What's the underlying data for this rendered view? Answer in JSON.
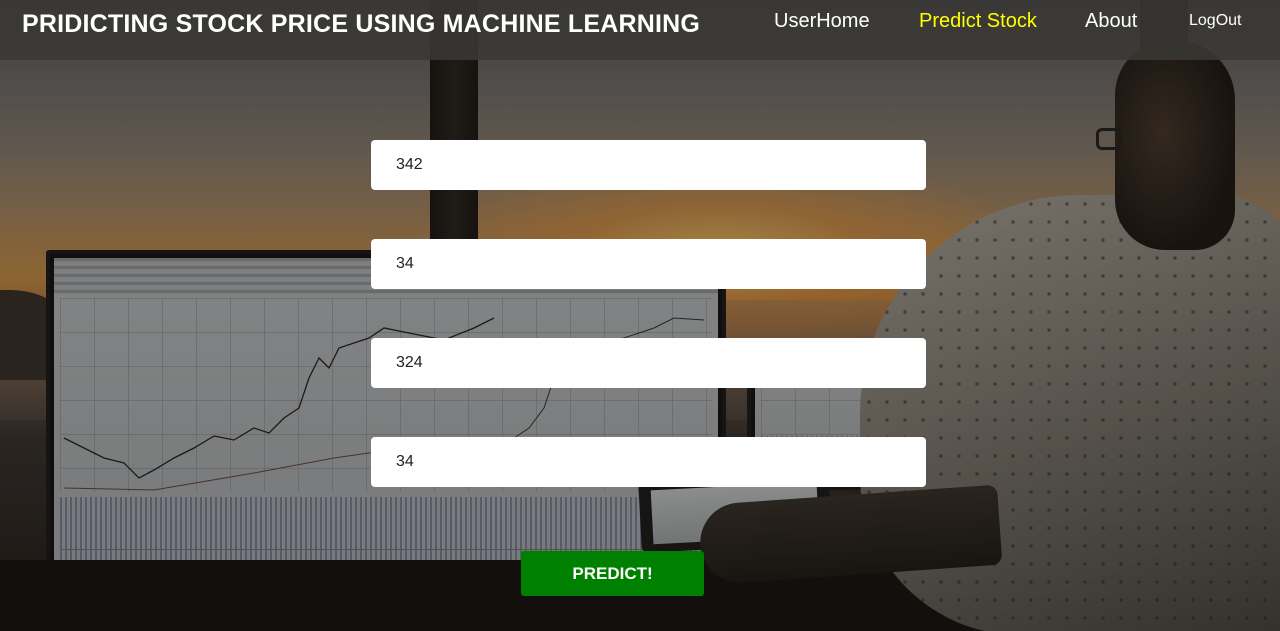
{
  "header": {
    "brand": "PRIDICTING STOCK PRICE USING MACHINE LEARNING",
    "nav": [
      {
        "label": "UserHome"
      },
      {
        "label": "Predict Stock"
      },
      {
        "label": "About"
      },
      {
        "label": "LogOut"
      }
    ],
    "active_color": "#ffff00"
  },
  "form": {
    "fields": [
      {
        "value": "342"
      },
      {
        "value": "34"
      },
      {
        "value": "324"
      },
      {
        "value": "34"
      }
    ],
    "submit_label": "PREDICT!",
    "submit_color": "#008000"
  }
}
